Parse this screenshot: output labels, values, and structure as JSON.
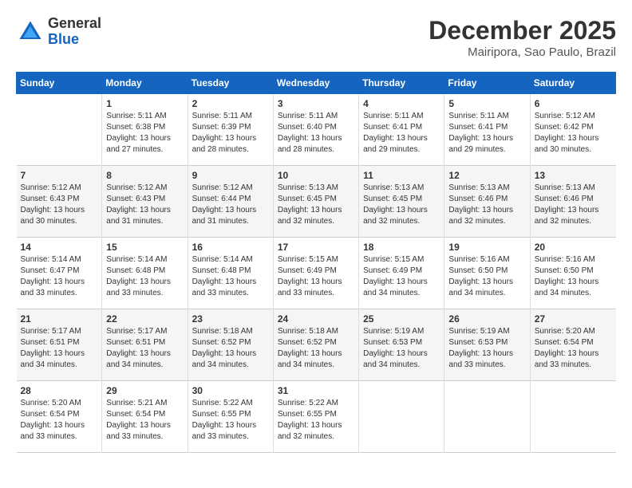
{
  "logo": {
    "line1": "General",
    "line2": "Blue"
  },
  "title": "December 2025",
  "subtitle": "Mairipora, Sao Paulo, Brazil",
  "weekdays": [
    "Sunday",
    "Monday",
    "Tuesday",
    "Wednesday",
    "Thursday",
    "Friday",
    "Saturday"
  ],
  "weeks": [
    [
      {
        "day": "",
        "info": ""
      },
      {
        "day": "1",
        "info": "Sunrise: 5:11 AM\nSunset: 6:38 PM\nDaylight: 13 hours\nand 27 minutes."
      },
      {
        "day": "2",
        "info": "Sunrise: 5:11 AM\nSunset: 6:39 PM\nDaylight: 13 hours\nand 28 minutes."
      },
      {
        "day": "3",
        "info": "Sunrise: 5:11 AM\nSunset: 6:40 PM\nDaylight: 13 hours\nand 28 minutes."
      },
      {
        "day": "4",
        "info": "Sunrise: 5:11 AM\nSunset: 6:41 PM\nDaylight: 13 hours\nand 29 minutes."
      },
      {
        "day": "5",
        "info": "Sunrise: 5:11 AM\nSunset: 6:41 PM\nDaylight: 13 hours\nand 29 minutes."
      },
      {
        "day": "6",
        "info": "Sunrise: 5:12 AM\nSunset: 6:42 PM\nDaylight: 13 hours\nand 30 minutes."
      }
    ],
    [
      {
        "day": "7",
        "info": "Sunrise: 5:12 AM\nSunset: 6:43 PM\nDaylight: 13 hours\nand 30 minutes."
      },
      {
        "day": "8",
        "info": "Sunrise: 5:12 AM\nSunset: 6:43 PM\nDaylight: 13 hours\nand 31 minutes."
      },
      {
        "day": "9",
        "info": "Sunrise: 5:12 AM\nSunset: 6:44 PM\nDaylight: 13 hours\nand 31 minutes."
      },
      {
        "day": "10",
        "info": "Sunrise: 5:13 AM\nSunset: 6:45 PM\nDaylight: 13 hours\nand 32 minutes."
      },
      {
        "day": "11",
        "info": "Sunrise: 5:13 AM\nSunset: 6:45 PM\nDaylight: 13 hours\nand 32 minutes."
      },
      {
        "day": "12",
        "info": "Sunrise: 5:13 AM\nSunset: 6:46 PM\nDaylight: 13 hours\nand 32 minutes."
      },
      {
        "day": "13",
        "info": "Sunrise: 5:13 AM\nSunset: 6:46 PM\nDaylight: 13 hours\nand 32 minutes."
      }
    ],
    [
      {
        "day": "14",
        "info": "Sunrise: 5:14 AM\nSunset: 6:47 PM\nDaylight: 13 hours\nand 33 minutes."
      },
      {
        "day": "15",
        "info": "Sunrise: 5:14 AM\nSunset: 6:48 PM\nDaylight: 13 hours\nand 33 minutes."
      },
      {
        "day": "16",
        "info": "Sunrise: 5:14 AM\nSunset: 6:48 PM\nDaylight: 13 hours\nand 33 minutes."
      },
      {
        "day": "17",
        "info": "Sunrise: 5:15 AM\nSunset: 6:49 PM\nDaylight: 13 hours\nand 33 minutes."
      },
      {
        "day": "18",
        "info": "Sunrise: 5:15 AM\nSunset: 6:49 PM\nDaylight: 13 hours\nand 34 minutes."
      },
      {
        "day": "19",
        "info": "Sunrise: 5:16 AM\nSunset: 6:50 PM\nDaylight: 13 hours\nand 34 minutes."
      },
      {
        "day": "20",
        "info": "Sunrise: 5:16 AM\nSunset: 6:50 PM\nDaylight: 13 hours\nand 34 minutes."
      }
    ],
    [
      {
        "day": "21",
        "info": "Sunrise: 5:17 AM\nSunset: 6:51 PM\nDaylight: 13 hours\nand 34 minutes."
      },
      {
        "day": "22",
        "info": "Sunrise: 5:17 AM\nSunset: 6:51 PM\nDaylight: 13 hours\nand 34 minutes."
      },
      {
        "day": "23",
        "info": "Sunrise: 5:18 AM\nSunset: 6:52 PM\nDaylight: 13 hours\nand 34 minutes."
      },
      {
        "day": "24",
        "info": "Sunrise: 5:18 AM\nSunset: 6:52 PM\nDaylight: 13 hours\nand 34 minutes."
      },
      {
        "day": "25",
        "info": "Sunrise: 5:19 AM\nSunset: 6:53 PM\nDaylight: 13 hours\nand 34 minutes."
      },
      {
        "day": "26",
        "info": "Sunrise: 5:19 AM\nSunset: 6:53 PM\nDaylight: 13 hours\nand 33 minutes."
      },
      {
        "day": "27",
        "info": "Sunrise: 5:20 AM\nSunset: 6:54 PM\nDaylight: 13 hours\nand 33 minutes."
      }
    ],
    [
      {
        "day": "28",
        "info": "Sunrise: 5:20 AM\nSunset: 6:54 PM\nDaylight: 13 hours\nand 33 minutes."
      },
      {
        "day": "29",
        "info": "Sunrise: 5:21 AM\nSunset: 6:54 PM\nDaylight: 13 hours\nand 33 minutes."
      },
      {
        "day": "30",
        "info": "Sunrise: 5:22 AM\nSunset: 6:55 PM\nDaylight: 13 hours\nand 33 minutes."
      },
      {
        "day": "31",
        "info": "Sunrise: 5:22 AM\nSunset: 6:55 PM\nDaylight: 13 hours\nand 32 minutes."
      },
      {
        "day": "",
        "info": ""
      },
      {
        "day": "",
        "info": ""
      },
      {
        "day": "",
        "info": ""
      }
    ]
  ]
}
